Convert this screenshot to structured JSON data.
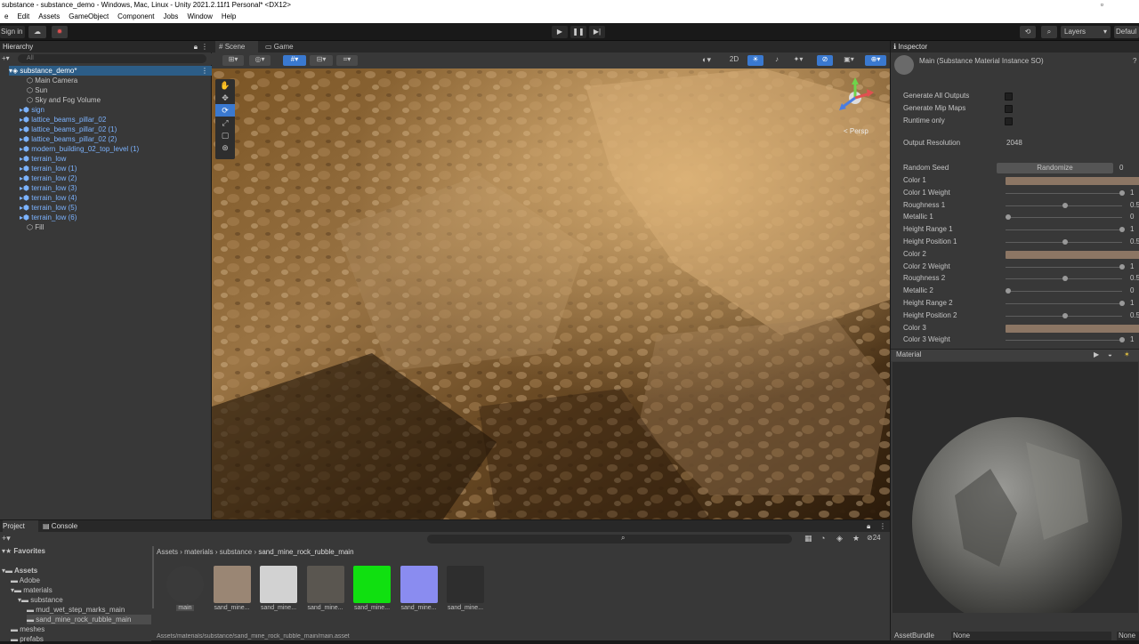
{
  "window": {
    "title": "substance - substance_demo - Windows, Mac, Linux - Unity 2021.2.11f1 Personal* <DX12>"
  },
  "menu": [
    "e",
    "Edit",
    "Assets",
    "GameObject",
    "Component",
    "Jobs",
    "Window",
    "Help"
  ],
  "toolbar": {
    "signin": "Sign in",
    "layers": "Layers",
    "layout": "Defaul"
  },
  "hierarchy": {
    "title": "Hierarchy",
    "search_placeholder": "All",
    "scene": "substance_demo*",
    "items": [
      {
        "label": "Main Camera",
        "prefab": false
      },
      {
        "label": "Sun",
        "prefab": false
      },
      {
        "label": "Sky and Fog Volume",
        "prefab": false
      },
      {
        "label": "sign",
        "prefab": true
      },
      {
        "label": "lattice_beams_pillar_02",
        "prefab": true
      },
      {
        "label": "lattice_beams_pillar_02 (1)",
        "prefab": true
      },
      {
        "label": "lattice_beams_pillar_02 (2)",
        "prefab": true
      },
      {
        "label": "modern_building_02_top_level (1)",
        "prefab": true
      },
      {
        "label": "terrain_low",
        "prefab": true
      },
      {
        "label": "terrain_low (1)",
        "prefab": true
      },
      {
        "label": "terrain_low (2)",
        "prefab": true
      },
      {
        "label": "terrain_low (3)",
        "prefab": true
      },
      {
        "label": "terrain_low (4)",
        "prefab": true
      },
      {
        "label": "terrain_low (5)",
        "prefab": true
      },
      {
        "label": "terrain_low (6)",
        "prefab": true
      },
      {
        "label": "Fill",
        "prefab": false
      }
    ]
  },
  "scene": {
    "tab_scene": "Scene",
    "tab_game": "Game",
    "mode_2d": "2D",
    "persp": "< Persp"
  },
  "inspector": {
    "title": "Inspector",
    "object": "Main (Substance Material Instance SO)",
    "generate_all_outputs": "Generate All Outputs",
    "generate_mip_maps": "Generate Mip Maps",
    "runtime_only": "Runtime only",
    "output_resolution_label": "Output Resolution",
    "output_resolution_value": "2048",
    "random_seed_label": "Random Seed",
    "randomize": "Randomize",
    "random_seed_value": "0",
    "params": [
      {
        "label": "Color 1",
        "kind": "color",
        "color": "#8c7664"
      },
      {
        "label": "Color 1 Weight",
        "kind": "slider",
        "fraction": 1.0,
        "value": "1"
      },
      {
        "label": "Roughness 1",
        "kind": "slider",
        "fraction": 0.5,
        "value": "0.5"
      },
      {
        "label": "Metallic 1",
        "kind": "slider",
        "fraction": 0.0,
        "value": "0"
      },
      {
        "label": "Height Range 1",
        "kind": "slider",
        "fraction": 1.0,
        "value": "1"
      },
      {
        "label": "Height Position 1",
        "kind": "slider",
        "fraction": 0.5,
        "value": "0.5"
      },
      {
        "label": "Color 2",
        "kind": "color",
        "color": "#8c7664"
      },
      {
        "label": "Color 2 Weight",
        "kind": "slider",
        "fraction": 1.0,
        "value": "1"
      },
      {
        "label": "Roughness 2",
        "kind": "slider",
        "fraction": 0.5,
        "value": "0.5"
      },
      {
        "label": "Metallic 2",
        "kind": "slider",
        "fraction": 0.0,
        "value": "0"
      },
      {
        "label": "Height Range 2",
        "kind": "slider",
        "fraction": 1.0,
        "value": "1"
      },
      {
        "label": "Height Position 2",
        "kind": "slider",
        "fraction": 0.5,
        "value": "0.5"
      },
      {
        "label": "Color 3",
        "kind": "color",
        "color": "#8c7664"
      },
      {
        "label": "Color 3 Weight",
        "kind": "slider",
        "fraction": 1.0,
        "value": "1"
      }
    ],
    "material_title": "Material",
    "assetbundle_label": "AssetBundle",
    "assetbundle_value": "None",
    "assetbundle_value2": "None"
  },
  "project": {
    "tab_project": "Project",
    "tab_console": "Console",
    "favorites": "Favorites",
    "tree": [
      {
        "label": "Assets",
        "bold": true
      },
      {
        "label": "Adobe"
      },
      {
        "label": "materials"
      },
      {
        "label": "substance"
      },
      {
        "label": "mud_wet_step_marks_main"
      },
      {
        "label": "sand_mine_rock_rubble_main",
        "selected": true
      },
      {
        "label": "meshes"
      },
      {
        "label": "prefabs"
      }
    ],
    "breadcrumb": [
      "Assets",
      "materials",
      "substance",
      "sand_mine_rock_rubble_main"
    ],
    "assets": [
      {
        "label": "main",
        "color": "#3a3a3a"
      },
      {
        "label": "sand_mine...",
        "color": "#9a8674"
      },
      {
        "label": "sand_mine...",
        "color": "#d2d2d2"
      },
      {
        "label": "sand_mine...",
        "color": "#5a5650"
      },
      {
        "label": "sand_mine...",
        "color": "#10e010"
      },
      {
        "label": "sand_mine...",
        "color": "#8a8cf0"
      },
      {
        "label": "sand_mine...",
        "color": "#2e2e2e"
      }
    ],
    "path": "Assets/materials/substance/sand_mine_rock_rubble_main/main.asset",
    "count": "24"
  },
  "colors": {
    "accent": "#3a79d0",
    "prefab": "#7cb3ff",
    "panel": "#383838",
    "dark": "#191919"
  }
}
